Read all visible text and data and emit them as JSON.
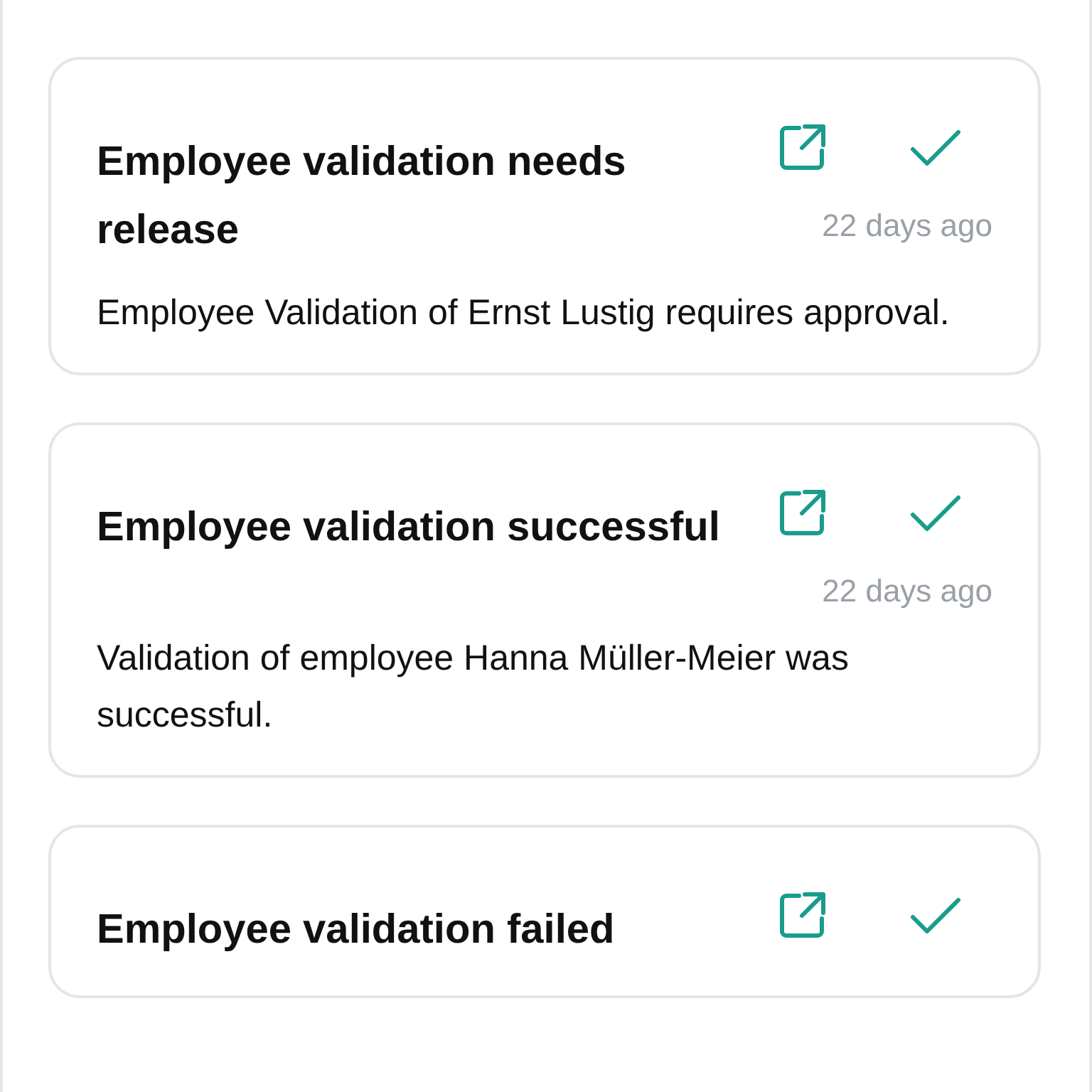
{
  "notifications": [
    {
      "title": "Employee validation needs release",
      "time": "22 days ago",
      "message": "Employee Validation of Ernst Lustig requires approval."
    },
    {
      "title": "Employee validation successful",
      "time": "22 days ago",
      "message": "Validation of employee Hanna Müller-Meier was successful."
    },
    {
      "title": "Employee validation failed"
    }
  ]
}
